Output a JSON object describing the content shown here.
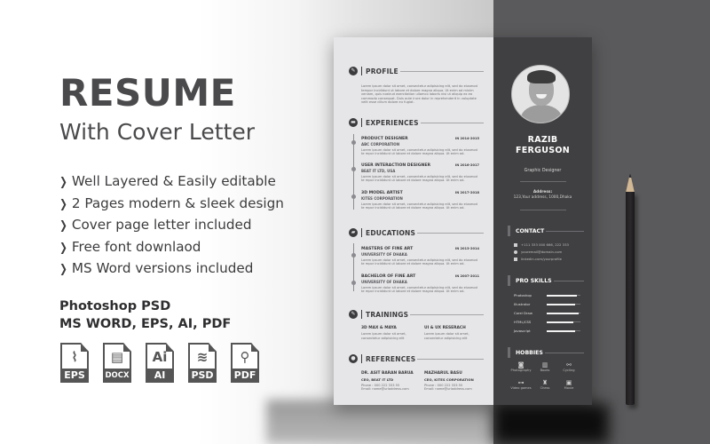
{
  "hero": {
    "title": "RESUME",
    "subtitle": "With Cover Letter",
    "features": [
      "Well Layered & Easily editable",
      "2 Pages modern & sleek design",
      "Cover page letter included",
      "Free font downlaod",
      "MS Word versions included"
    ],
    "formats_line1": "Photoshop PSD",
    "formats_line2": "MS WORD, EPS, AI, PDF",
    "file_icons": [
      {
        "icon": "eps-file-icon",
        "label": "EPS",
        "glyph": "⌇"
      },
      {
        "icon": "docx-file-icon",
        "label": "DOCX",
        "glyph": "▤"
      },
      {
        "icon": "ai-file-icon",
        "label": "AI",
        "glyph": "Ai"
      },
      {
        "icon": "psd-file-icon",
        "label": "PSD",
        "glyph": "≋"
      },
      {
        "icon": "pdf-file-icon",
        "label": "PDF",
        "glyph": "⚲"
      }
    ]
  },
  "resume": {
    "lorem_long": "Lorem ipsum dolor sit amet, consectetur adipisicing elit, sed do eiusmod tempor incididunt ut labore et dolore magna aliqua. Ut enim ad minim veniam, quis nostrud exercitation ullamco laboris nisi ut aliquip ex ea commodo consequat. Duis aute irure dolor in reprehenderit in voluptate velit esse cillum dolore eu fugiat.",
    "lorem_short": "Lorem ipsum dolor sit amet, consectetur adipisicing elit, sed do eiusmod te mpor incididunt ut labore et dolore magna aliqua. Ut enim ad.",
    "sections": {
      "profile": "PROFILE",
      "experiences": "EXPERIENCES",
      "educations": "EDUCATIONS",
      "trainings": "TRAININGS",
      "references": "REFERENCES",
      "contact": "CONTACT",
      "pro_skills": "PRO SKILLS",
      "hobbies": "HOBBIES"
    },
    "experiences": [
      {
        "role": "PRODUCT DESIGNER",
        "org": "ABC CORPORATION",
        "date": "IN 2014-2015"
      },
      {
        "role": "USER INTERACTION DESIGNER",
        "org": "BEAT IT LTD, USA",
        "date": "IN 2016-2017"
      },
      {
        "role": "3D MODEL ARTIST",
        "org": "KITES CORPORATION",
        "date": "IN 2017-2018"
      }
    ],
    "educations": [
      {
        "role": "MASTERS OF FINE ART",
        "org": "UNIVERSITY OF DHAKA",
        "date": "IN 2013-2014"
      },
      {
        "role": "BACHELOR OF FINE ART",
        "org": "UNIVERSITY OF DHAKA",
        "date": "IN 2007-2011"
      }
    ],
    "trainings": [
      {
        "title": "3D MAX & MAYA",
        "line1": "Lorem ipsum dolor sit amet,",
        "line2": "consectetur adipisicing elit"
      },
      {
        "title": "UI & UX RESERACH",
        "line1": "Lorem ipsum dolor sit amet,",
        "line2": "consectetur adipisicing elit"
      }
    ],
    "references": [
      {
        "name": "DR. ASIT BARAN BARUA",
        "position": "CEO, BEAT IT LTD",
        "phone": "Phone : 000 222 333 55",
        "email": "Email: name@urladdress.com"
      },
      {
        "name": "MAZHARUL BASU",
        "position": "CEO, KITES CORPORATION",
        "phone": "Phone : 000 222 333 55",
        "email": "Email: name@urladdress.com"
      }
    ],
    "person": {
      "first_name": "RAZIB",
      "last_name": "FERGUSON",
      "job_title": "Graphic Designer",
      "address_label": "Address:",
      "address_value": "123,Your address, 1000,Dhaka"
    },
    "contact": [
      {
        "icon": "phone-icon",
        "text": "+111 333 000 666, 222 333"
      },
      {
        "icon": "globe-icon",
        "text": "youremail@domain.com"
      },
      {
        "icon": "linkedin-icon",
        "text": "linkedin.com/yourprofile"
      }
    ],
    "skills": [
      {
        "name": "Photoshop",
        "level": 0.9
      },
      {
        "name": "Illustrator",
        "level": 0.85
      },
      {
        "name": "Corel Draw",
        "level": 0.95
      },
      {
        "name": "HTML/CSS",
        "level": 0.8
      },
      {
        "name": "Javascript",
        "level": 0.85
      }
    ],
    "hobbies": [
      {
        "icon": "camera-icon",
        "glyph": "◙",
        "name": "Photography"
      },
      {
        "icon": "books-icon",
        "glyph": "▥",
        "name": "Books"
      },
      {
        "icon": "bicycle-icon",
        "glyph": "⚯",
        "name": "Cycling"
      },
      {
        "icon": "gamepad-icon",
        "glyph": "⊶",
        "name": "Video games"
      },
      {
        "icon": "chess-icon",
        "glyph": "♜",
        "name": "Chess"
      },
      {
        "icon": "movie-icon",
        "glyph": "▣",
        "name": "Movie"
      }
    ]
  }
}
